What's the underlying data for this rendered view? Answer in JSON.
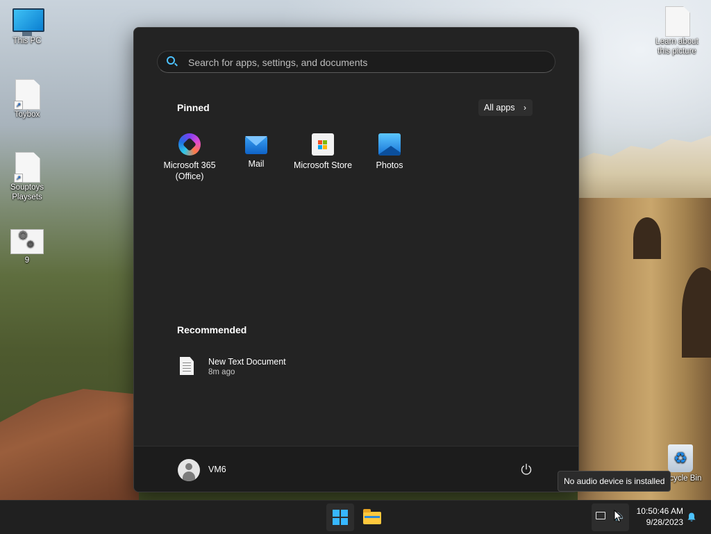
{
  "desktop": {
    "icons": [
      {
        "label": "This PC"
      },
      {
        "label": "Toybox"
      },
      {
        "label": "Souptoys Playsets"
      },
      {
        "label": "9"
      },
      {
        "label": "Learn about this picture"
      },
      {
        "label": "Recycle Bin"
      }
    ]
  },
  "start_menu": {
    "search": {
      "placeholder": "Search for apps, settings, and documents"
    },
    "pinned": {
      "title": "Pinned",
      "all_apps_label": "All apps",
      "apps": [
        {
          "label": "Microsoft 365 (Office)",
          "icon": "microsoft-365-icon"
        },
        {
          "label": "Mail",
          "icon": "mail-icon"
        },
        {
          "label": "Microsoft Store",
          "icon": "microsoft-store-icon"
        },
        {
          "label": "Photos",
          "icon": "photos-icon"
        }
      ]
    },
    "recommended": {
      "title": "Recommended",
      "items": [
        {
          "name": "New Text Document",
          "time": "8m ago",
          "icon": "text-document-icon"
        }
      ]
    },
    "footer": {
      "user_name": "VM6",
      "power_icon": "power-icon"
    }
  },
  "tooltip": {
    "text": "No audio device is installed"
  },
  "taskbar": {
    "clock": {
      "time": "10:50:46 AM",
      "date": "9/28/2023"
    },
    "icons": [
      "windows-start-icon",
      "file-explorer-icon",
      "network-icon",
      "volume-icon",
      "notification-bell-icon"
    ]
  },
  "colors": {
    "accent": "#4cc2ff",
    "start_menu_bg": "#232323",
    "taskbar_bg": "#202020",
    "windows_logo": "#37b7ff"
  }
}
